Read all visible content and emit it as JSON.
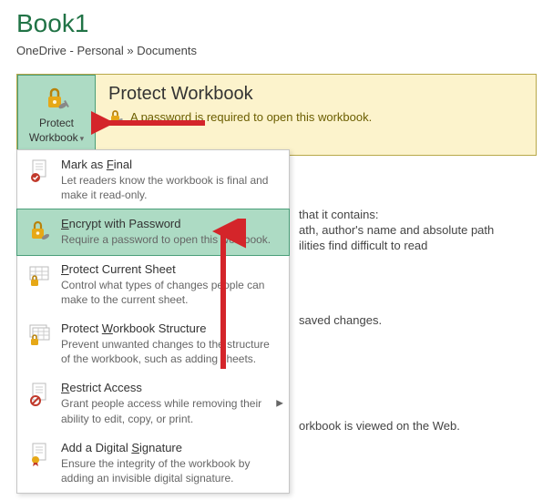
{
  "header": {
    "title": "Book1",
    "breadcrumb": "OneDrive - Personal » Documents"
  },
  "panel": {
    "title": "Protect Workbook",
    "subtitle": "A password is required to open this workbook.",
    "button_line1": "Protect",
    "button_line2": "Workbook"
  },
  "menu": {
    "items": [
      {
        "title_pre": "Mark as ",
        "title_u": "F",
        "title_post": "inal",
        "desc": "Let readers know the workbook is final and make it read-only."
      },
      {
        "title_pre": "",
        "title_u": "E",
        "title_post": "ncrypt with Password",
        "desc": "Require a password to open this workbook."
      },
      {
        "title_pre": "",
        "title_u": "P",
        "title_post": "rotect Current Sheet",
        "desc": "Control what types of changes people can make to the current sheet."
      },
      {
        "title_pre": "Protect ",
        "title_u": "W",
        "title_post": "orkbook Structure",
        "desc": "Prevent unwanted changes to the structure of the workbook, such as adding sheets."
      },
      {
        "title_pre": "",
        "title_u": "R",
        "title_post": "estrict Access",
        "desc": "Grant people access while removing their ability to edit, copy, or print."
      },
      {
        "title_pre": "Add a Digital ",
        "title_u": "S",
        "title_post": "ignature",
        "desc": "Ensure the integrity of the workbook by adding an invisible digital signature."
      }
    ]
  },
  "bg": {
    "line1": "that it contains:",
    "line2": "ath, author's name and absolute path",
    "line3": "ilities find difficult to read",
    "line4": "saved changes.",
    "line5": "orkbook is viewed on the Web."
  }
}
